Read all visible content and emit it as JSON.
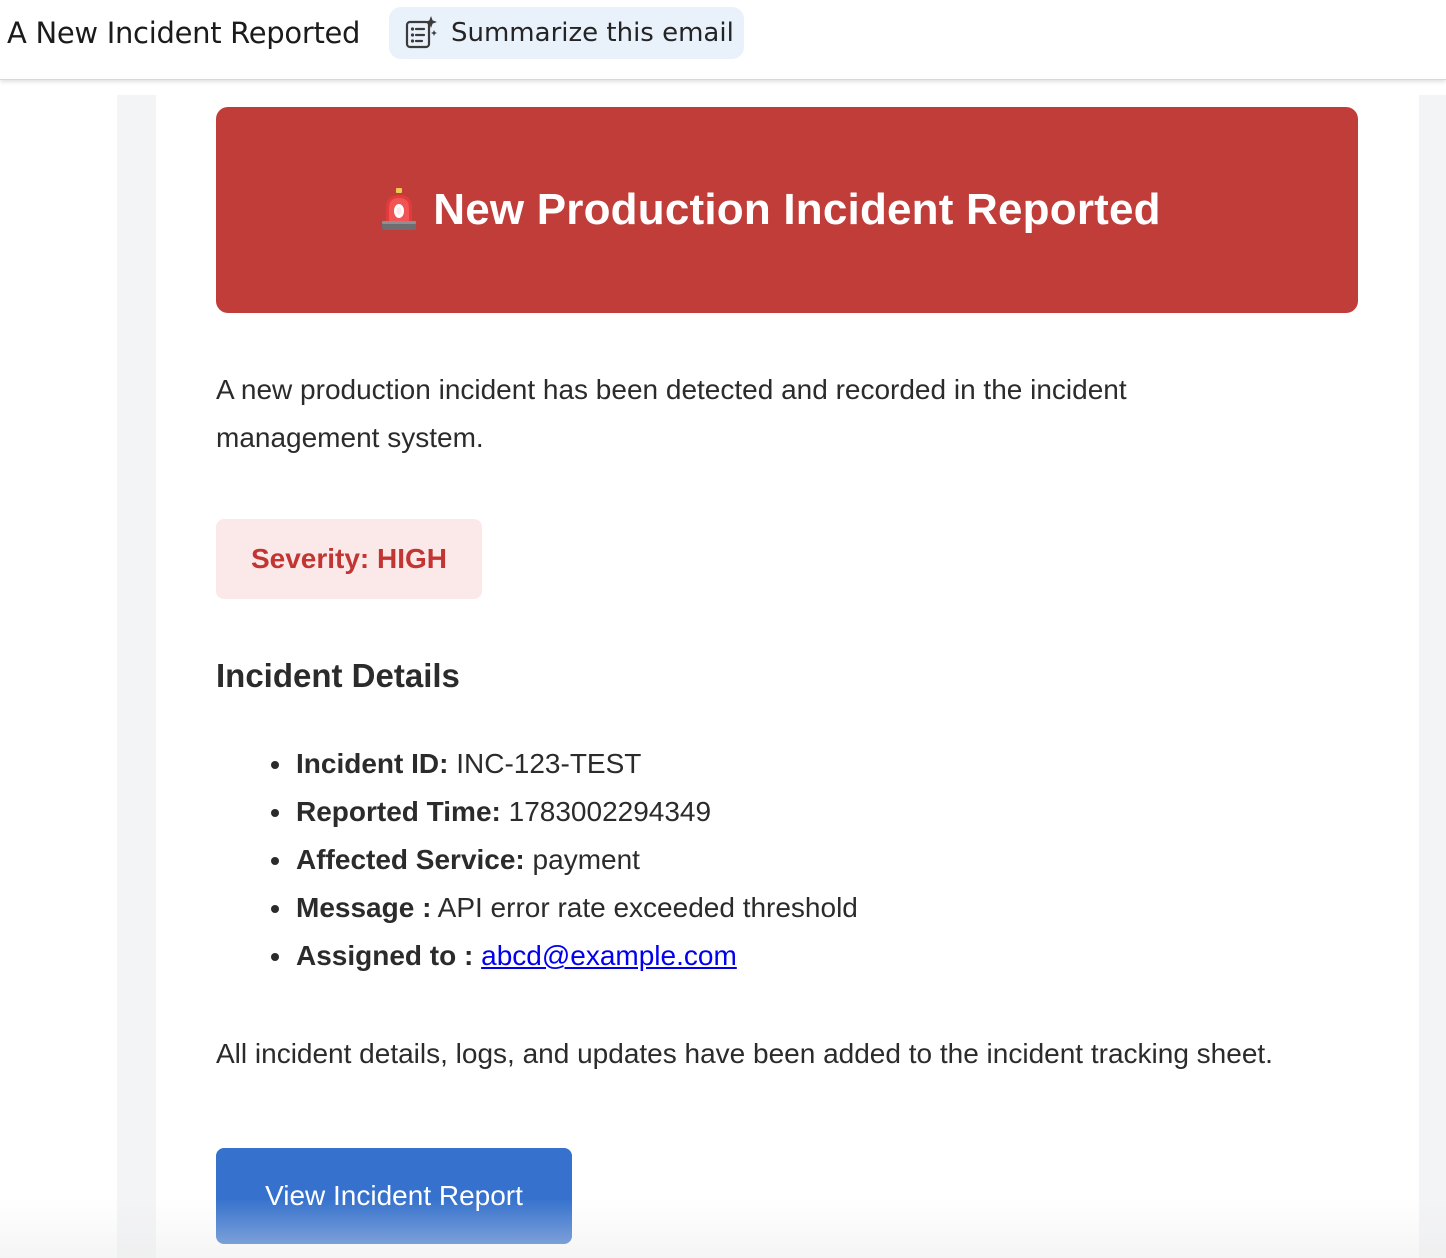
{
  "header": {
    "subject": "A New Incident Reported",
    "summarize_label": "Summarize this email",
    "summarize_icon": "summary-sparkle-icon"
  },
  "email": {
    "banner": {
      "icon": "siren-icon",
      "title": "New Production Incident Reported",
      "color": "#c13d3a"
    },
    "intro": "A new production incident has been detected and recorded in the incident management system.",
    "severity": {
      "label": "Severity: HIGH",
      "color": "#c13532",
      "background": "#fbe9e9"
    },
    "details_heading": "Incident Details",
    "details": [
      {
        "label": "Incident ID:",
        "value": "INC-123-TEST"
      },
      {
        "label": "Reported Time:",
        "value": "1783002294349"
      },
      {
        "label": "Affected Service:",
        "value": "payment"
      },
      {
        "label": "Message :",
        "value": "API error rate exceeded threshold"
      },
      {
        "label": "Assigned to :",
        "value": "abcd@example.com"
      }
    ],
    "closing": "All incident details, logs, and updates have been added to the incident tracking sheet.",
    "cta_label": "View Incident Report",
    "cta_color": "#3571cd"
  }
}
